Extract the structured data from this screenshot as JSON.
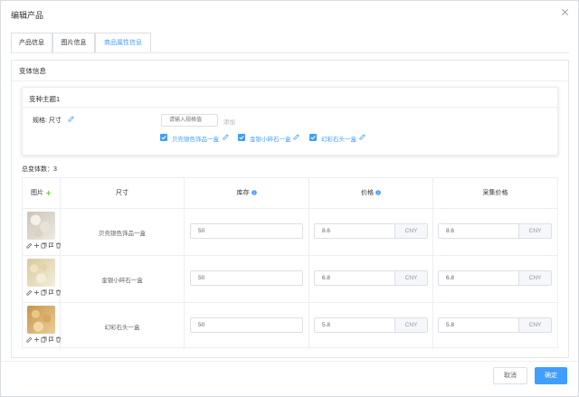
{
  "dialog": {
    "title": "编辑产品",
    "close_icon": "close-icon"
  },
  "tabs": [
    {
      "label": "产品信息",
      "active": false
    },
    {
      "label": "图片信息",
      "active": false
    },
    {
      "label": "商品属性信息",
      "active": true
    }
  ],
  "variant_section": {
    "title": "变体信息",
    "theme": {
      "title": "变种主题1",
      "spec_label": "规格: 尺寸",
      "input_placeholder": "请输入规格值",
      "add_label": "添加",
      "options": [
        {
          "label": "贝壳银色饰品一盒",
          "checked": true
        },
        {
          "label": "金银小碎石一盒",
          "checked": true
        },
        {
          "label": "幻彩石头一盒",
          "checked": true
        }
      ]
    },
    "total_label": "总变体数：3"
  },
  "table": {
    "headers": {
      "image": "图片",
      "size": "尺寸",
      "stock": "库存",
      "price": "价格",
      "purchase_price": "采集价格"
    },
    "rows": [
      {
        "size": "贝壳银色饰品一盒",
        "stock": "50",
        "price": "8.6",
        "price_unit": "CNY",
        "purchase_price": "8.6",
        "purchase_unit": "CNY"
      },
      {
        "size": "金银小碎石一盒",
        "stock": "50",
        "price": "6.8",
        "price_unit": "CNY",
        "purchase_price": "6.8",
        "purchase_unit": "CNY"
      },
      {
        "size": "幻彩石头一盒",
        "stock": "50",
        "price": "5.8",
        "price_unit": "CNY",
        "purchase_price": "5.8",
        "purchase_unit": "CNY"
      }
    ]
  },
  "footer": {
    "cancel_label": "取消",
    "ok_label": "确定"
  },
  "colors": {
    "accent": "#409eff",
    "border": "#dcdfe6"
  }
}
